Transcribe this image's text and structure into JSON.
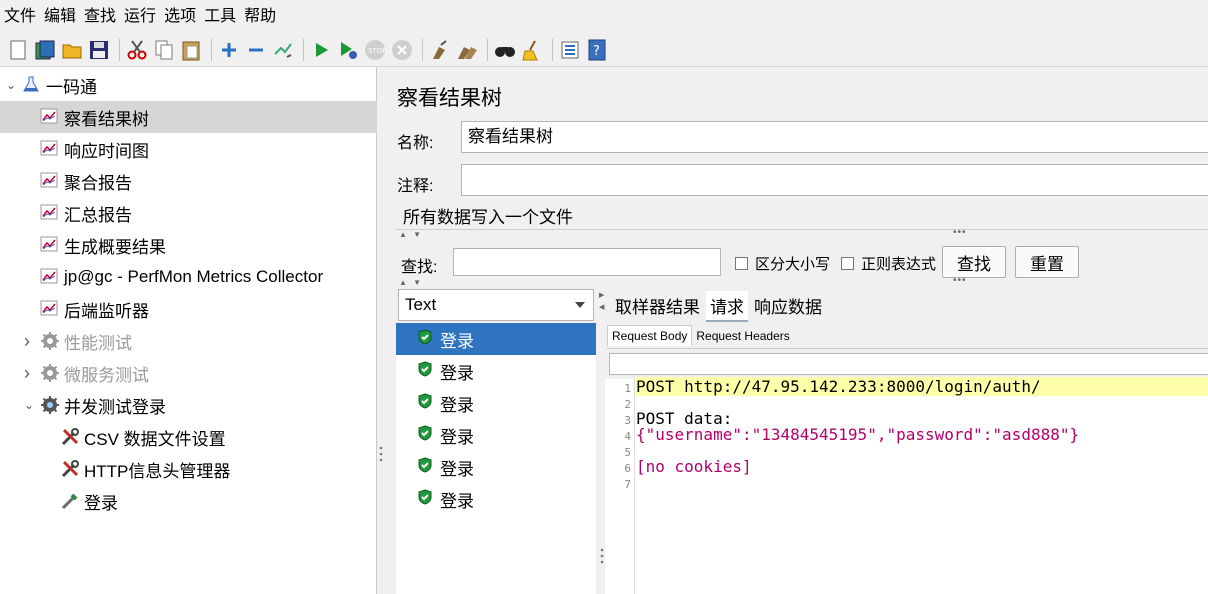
{
  "menu": [
    "文件",
    "编辑",
    "查找",
    "运行",
    "选项",
    "工具",
    "帮助"
  ],
  "toolbar": {
    "groups": [
      [
        "new-file-icon",
        "templates-icon",
        "open-folder-icon",
        "save-icon"
      ],
      [
        "cut-icon",
        "copy-icon",
        "paste-icon"
      ],
      [
        "expand-icon",
        "collapse-icon",
        "toggle-icon"
      ],
      [
        "start-icon",
        "start-no-pause-icon",
        "stop-icon",
        "shutdown-icon"
      ],
      [
        "clear-icon",
        "clear-all-icon"
      ],
      [
        "search-binoculars-icon",
        "reset-search-broom-icon"
      ],
      [
        "function-helper-icon",
        "help-icon"
      ]
    ]
  },
  "tree": [
    {
      "label": "一码通",
      "level": 0,
      "caret": "open",
      "icon": "flask-icon",
      "selected": false,
      "disabled": false
    },
    {
      "label": "察看结果树",
      "level": 1,
      "caret": "",
      "icon": "chart-icon",
      "selected": true,
      "disabled": false
    },
    {
      "label": "响应时间图",
      "level": 1,
      "caret": "",
      "icon": "chart-icon",
      "selected": false,
      "disabled": false
    },
    {
      "label": "聚合报告",
      "level": 1,
      "caret": "",
      "icon": "chart-icon",
      "selected": false,
      "disabled": false
    },
    {
      "label": "汇总报告",
      "level": 1,
      "caret": "",
      "icon": "chart-icon",
      "selected": false,
      "disabled": false
    },
    {
      "label": "生成概要结果",
      "level": 1,
      "caret": "",
      "icon": "chart-icon",
      "selected": false,
      "disabled": false
    },
    {
      "label": "jp@gc - PerfMon Metrics Collector",
      "level": 1,
      "caret": "",
      "icon": "chart-icon",
      "selected": false,
      "disabled": false
    },
    {
      "label": "后端监听器",
      "level": 1,
      "caret": "",
      "icon": "chart-icon",
      "selected": false,
      "disabled": false
    },
    {
      "label": "性能测试",
      "level": 1,
      "caret": "closed",
      "icon": "gear-icon",
      "selected": false,
      "disabled": true
    },
    {
      "label": "微服务测试",
      "level": 1,
      "caret": "closed",
      "icon": "gear-icon",
      "selected": false,
      "disabled": true
    },
    {
      "label": "并发测试登录",
      "level": 1,
      "caret": "open",
      "icon": "gear-icon",
      "selected": false,
      "disabled": false
    },
    {
      "label": "CSV 数据文件设置",
      "level": 2,
      "caret": "",
      "icon": "wrench-icon",
      "selected": false,
      "disabled": false
    },
    {
      "label": "HTTP信息头管理器",
      "level": 2,
      "caret": "",
      "icon": "wrench-icon",
      "selected": false,
      "disabled": false
    },
    {
      "label": "登录",
      "level": 2,
      "caret": "",
      "icon": "pipette-icon",
      "selected": false,
      "disabled": false
    }
  ],
  "panel": {
    "title": "察看结果树",
    "name_label": "名称:",
    "name_value": "察看结果树",
    "comment_label": "注释:",
    "comment_value": "",
    "file_section": "所有数据写入一个文件",
    "search_label": "查找:",
    "search_value": "",
    "case_label": "区分大小写",
    "regex_label": "正则表达式",
    "find_button": "查找",
    "reset_button": "重置"
  },
  "results": {
    "renderer": "Text",
    "items": [
      {
        "label": "登录",
        "selected": true
      },
      {
        "label": "登录",
        "selected": false
      },
      {
        "label": "登录",
        "selected": false
      },
      {
        "label": "登录",
        "selected": false
      },
      {
        "label": "登录",
        "selected": false
      },
      {
        "label": "登录",
        "selected": false
      }
    ]
  },
  "detail": {
    "tabs": [
      {
        "label": "取样器结果",
        "active": false
      },
      {
        "label": "请求",
        "active": true
      },
      {
        "label": "响应数据",
        "active": false
      }
    ],
    "subtabs": [
      {
        "label": "Request Body",
        "active": true
      },
      {
        "label": "Request Headers",
        "active": false
      }
    ],
    "lines": [
      {
        "n": "1",
        "text": "POST http://47.95.142.233:8000/login/auth/"
      },
      {
        "n": "2",
        "text": ""
      },
      {
        "n": "3",
        "text": "POST data:"
      },
      {
        "n": "4",
        "text": "{\"username\":\"13484545195\",\"password\":\"asd888\"}"
      },
      {
        "n": "5",
        "text": ""
      },
      {
        "n": "6",
        "text": "[no cookies]"
      },
      {
        "n": "7",
        "text": ""
      }
    ]
  }
}
